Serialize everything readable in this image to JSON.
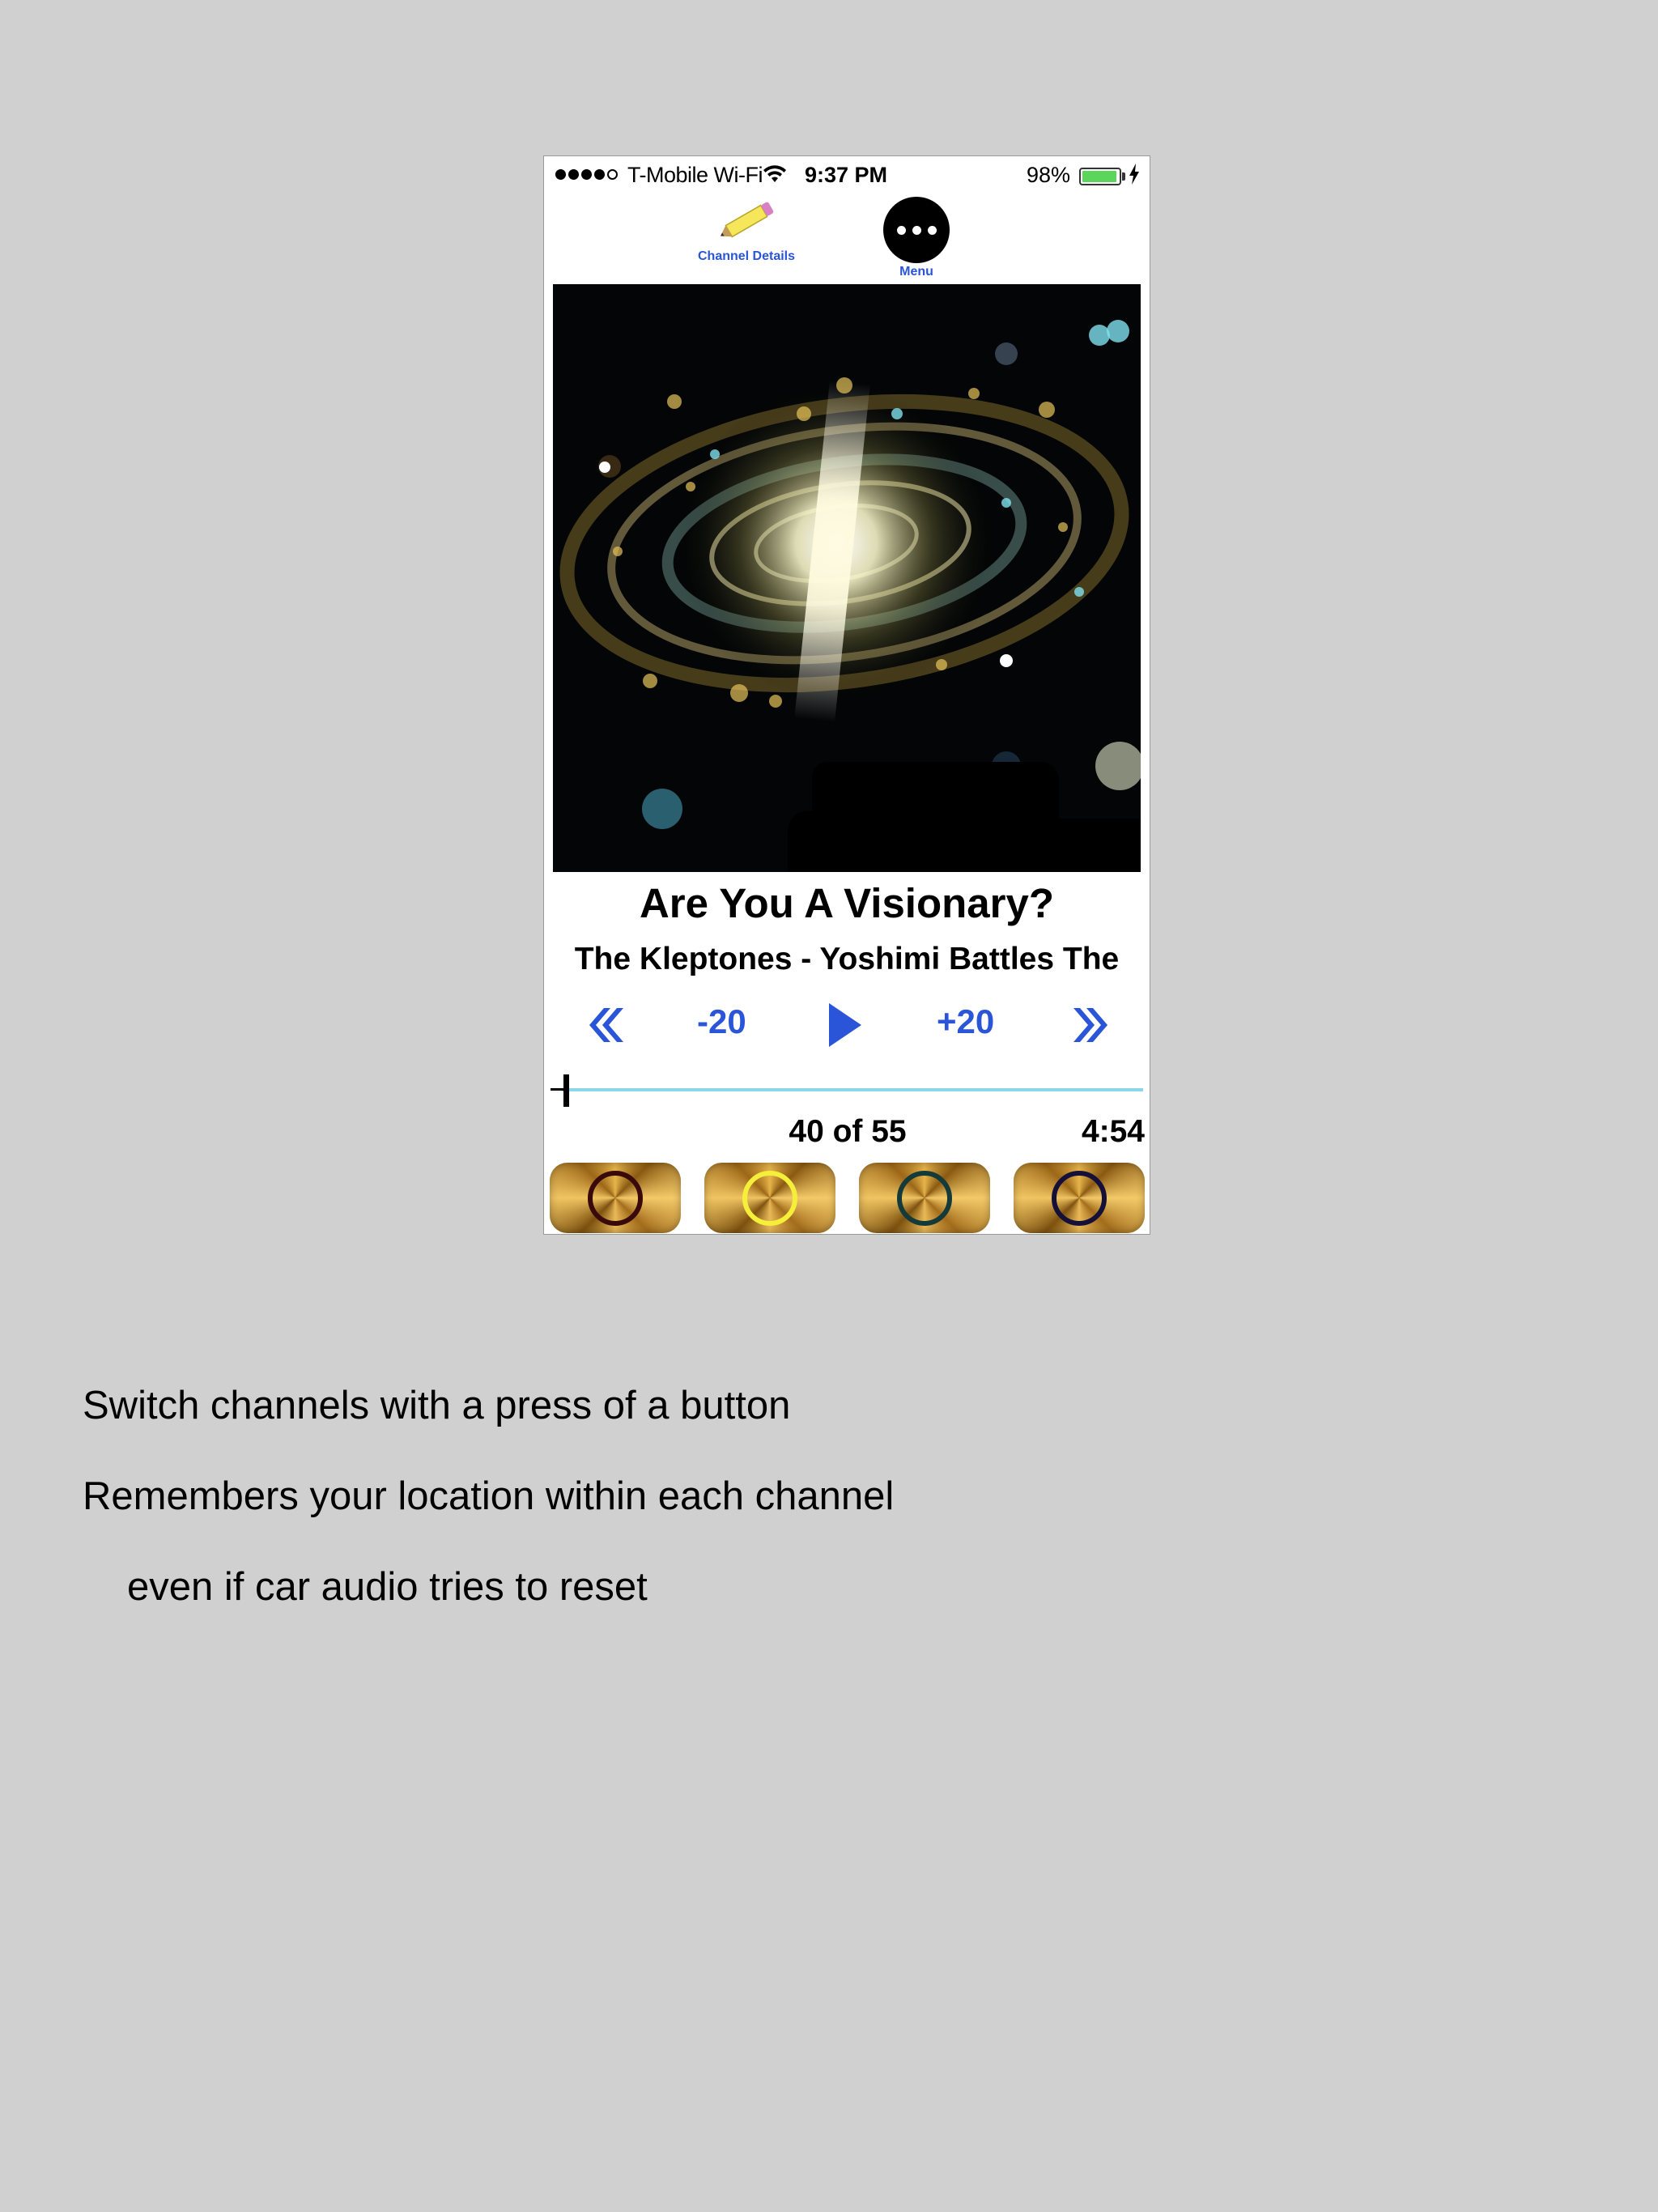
{
  "statusbar": {
    "carrier": "T-Mobile Wi-Fi",
    "time": "9:37 PM",
    "battery_percent": "98%",
    "signal_bars_filled": 4,
    "signal_bars_total": 5,
    "battery_level": 0.98,
    "battery_color": "#5bd55c",
    "charging": true
  },
  "toolbar": {
    "details_label": "Channel Details",
    "menu_label": "Menu",
    "details_icon": "pencil-icon",
    "menu_icon": "more-dots-icon"
  },
  "now_playing": {
    "title": "Are You A Visionary?",
    "subtitle": "The Kleptones - Yoshimi Battles The",
    "artwork": "galaxy-spiral-artwork"
  },
  "transport": {
    "rewind_icon": "double-chevron-left-icon",
    "back_label": "-20",
    "play_icon": "play-icon",
    "forward_label": "+20",
    "fast_forward_icon": "double-chevron-right-icon",
    "accent_color": "#2a55d8"
  },
  "progress": {
    "position_fraction": 0.01,
    "track_color": "#8ad7ea",
    "track_count": "40 of 55",
    "duration": "4:54"
  },
  "channels": [
    {
      "ring_color": "#3a0a0a"
    },
    {
      "ring_color": "#f5ef3a"
    },
    {
      "ring_color": "#153a3a"
    },
    {
      "ring_color": "#15103a"
    }
  ],
  "captions": {
    "line1": "Switch channels with a press of a button",
    "line2": "Remembers your location within each channel",
    "line3": "even if car audio tries to reset"
  }
}
